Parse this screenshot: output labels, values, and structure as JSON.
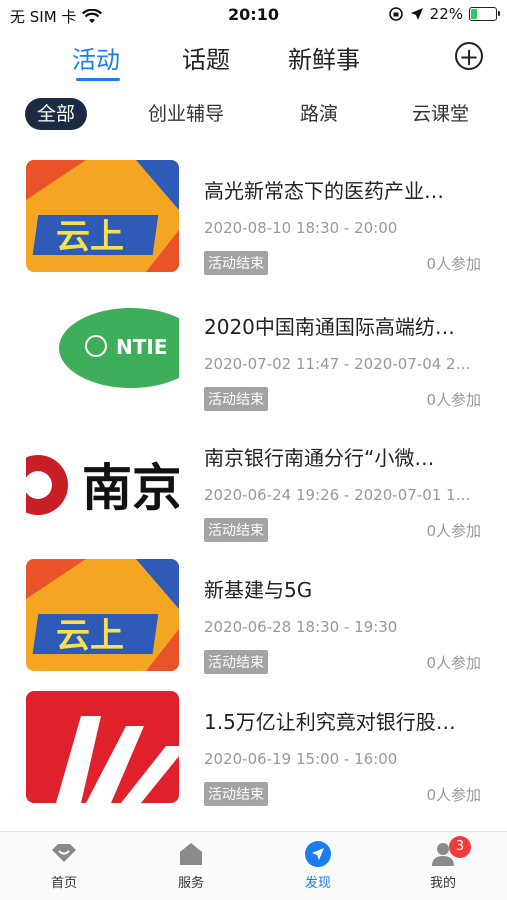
{
  "status": {
    "carrier": "无 SIM 卡",
    "time": "20:10",
    "battery_percent": "22%",
    "battery_level": 0.22
  },
  "top_tabs": [
    {
      "label": "活动"
    },
    {
      "label": "话题"
    },
    {
      "label": "新鲜事"
    }
  ],
  "filters": [
    {
      "label": "全部"
    },
    {
      "label": "创业辅导"
    },
    {
      "label": "路演"
    },
    {
      "label": "云课堂"
    }
  ],
  "events": [
    {
      "title": "高光新常态下的医药产业…",
      "time": "2020-08-10 18:30 - 20:00",
      "status": "活动结束",
      "count": "0人参加",
      "thumb_text": "云上"
    },
    {
      "title": "2020中国南通国际高端纺…",
      "time": "2020-07-02 11:47 - 2020-07-04 2…",
      "status": "活动结束",
      "count": "0人参加",
      "thumb_text": "NTIE"
    },
    {
      "title": "南京银行南通分行“小微…",
      "time": "2020-06-24 19:26 - 2020-07-01 1…",
      "status": "活动结束",
      "count": "0人参加",
      "thumb_text": "南京"
    },
    {
      "title": "新基建与5G",
      "time": "2020-06-28 18:30 - 19:30",
      "status": "活动结束",
      "count": "0人参加",
      "thumb_text": "云上"
    },
    {
      "title": "1.5万亿让利究竟对银行股…",
      "time": "2020-06-19 15:00 - 16:00",
      "status": "活动结束",
      "count": "0人参加",
      "thumb_text": ""
    }
  ],
  "tabbar": [
    {
      "label": "首页",
      "icon": "home-icon"
    },
    {
      "label": "服务",
      "icon": "service-icon"
    },
    {
      "label": "发现",
      "icon": "discover-icon"
    },
    {
      "label": "我的",
      "icon": "profile-icon",
      "badge": "3"
    }
  ],
  "colors": {
    "accent": "#1a7df0",
    "chip_active_bg": "#1c2a44",
    "badge_red": "#f23c3c"
  }
}
